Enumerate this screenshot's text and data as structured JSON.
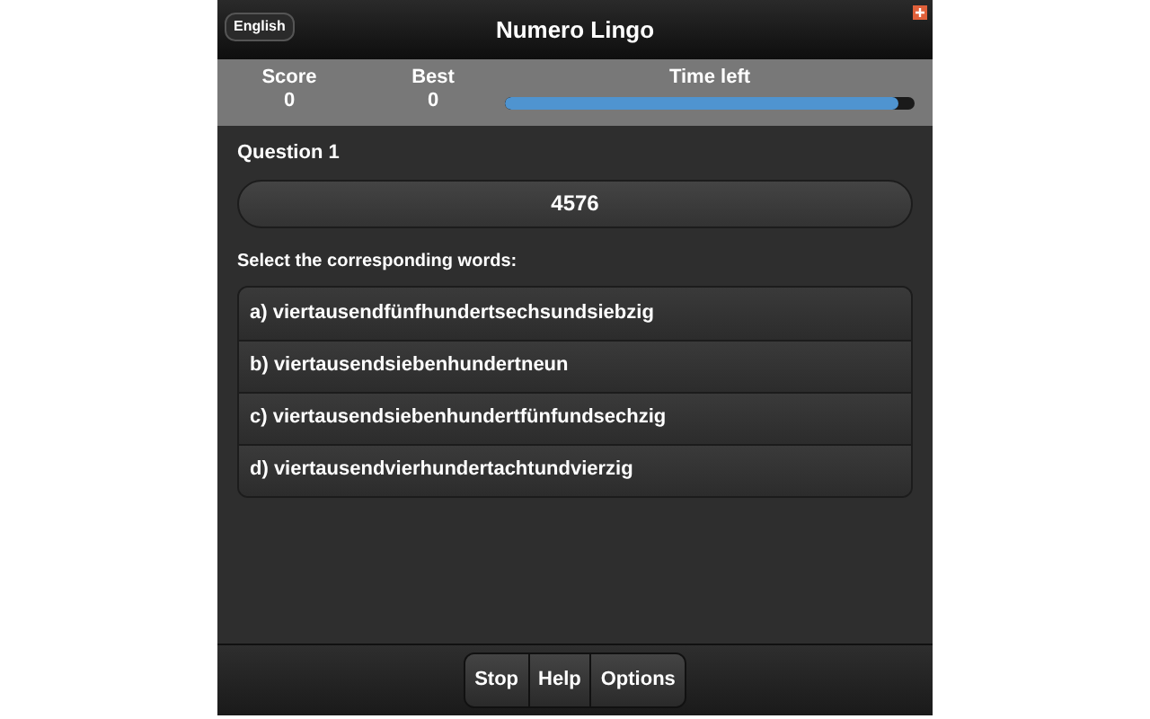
{
  "header": {
    "language_button": "English",
    "title": "Numero Lingo"
  },
  "stats": {
    "score_label": "Score",
    "score": "0",
    "best_label": "Best",
    "best": "0",
    "time_label": "Time left",
    "time_bar": {
      "level": 0.96
    }
  },
  "question": {
    "label": "Question 1",
    "number": "4576"
  },
  "prompt": "Select the corresponding words:",
  "answers": [
    {
      "text": "a) viertausendfünfhundertsechsundsiebzig"
    },
    {
      "text": "b) viertausendsiebenhundertneun"
    },
    {
      "text": "c) viertausendsiebenhundertfünfundsechzig"
    },
    {
      "text": "d) viertausendvierhundertachtundvierzig"
    }
  ],
  "footer_buttons": [
    "Stop",
    "Help",
    "Options"
  ]
}
